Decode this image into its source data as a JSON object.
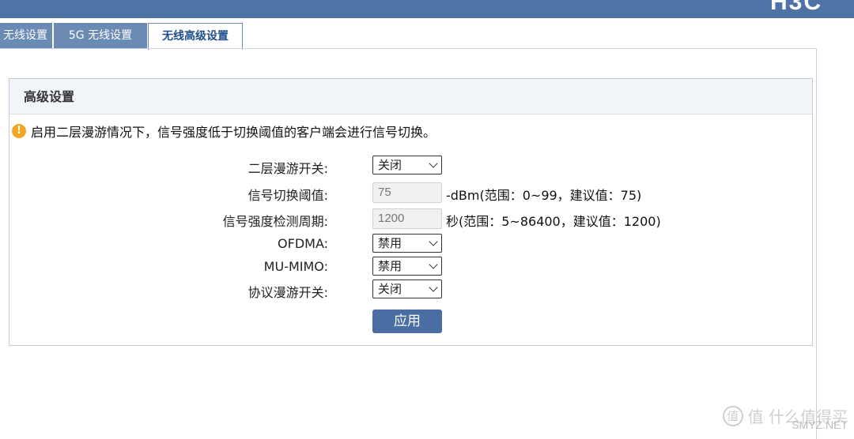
{
  "header": {
    "brand": "H3C"
  },
  "tabs": [
    {
      "label": "无线设置",
      "active": false
    },
    {
      "label": "5G 无线设置",
      "active": false
    },
    {
      "label": "无线高级设置",
      "active": true
    }
  ],
  "panel": {
    "title": "高级设置",
    "notice": "启用二层漫游情况下，信号强度低于切换阈值的客户端会进行信号切换。",
    "fields": {
      "roaming": {
        "label": "二层漫游开关:",
        "value": "关闭"
      },
      "threshold": {
        "label": "信号切换阈值:",
        "value": "75",
        "hint": "-dBm(范围：0~99，建议值：75)"
      },
      "period": {
        "label": "信号强度检测周期:",
        "value": "1200",
        "hint": "秒(范围：5~86400，建议值：1200)"
      },
      "ofdma": {
        "label": "OFDMA:",
        "value": "禁用"
      },
      "mumimo": {
        "label": "MU-MIMO:",
        "value": "禁用"
      },
      "protocol_roaming": {
        "label": "协议漫游开关:",
        "value": "关闭"
      }
    },
    "apply_label": "应用"
  },
  "watermark": {
    "text": "值 什么值得买",
    "site": "SMYZ.NET"
  },
  "colors": {
    "header": "#4e74a6",
    "tab_inactive": "#6b8bb5",
    "accent_button": "#4a6ea3",
    "warning": "#f5a623"
  }
}
